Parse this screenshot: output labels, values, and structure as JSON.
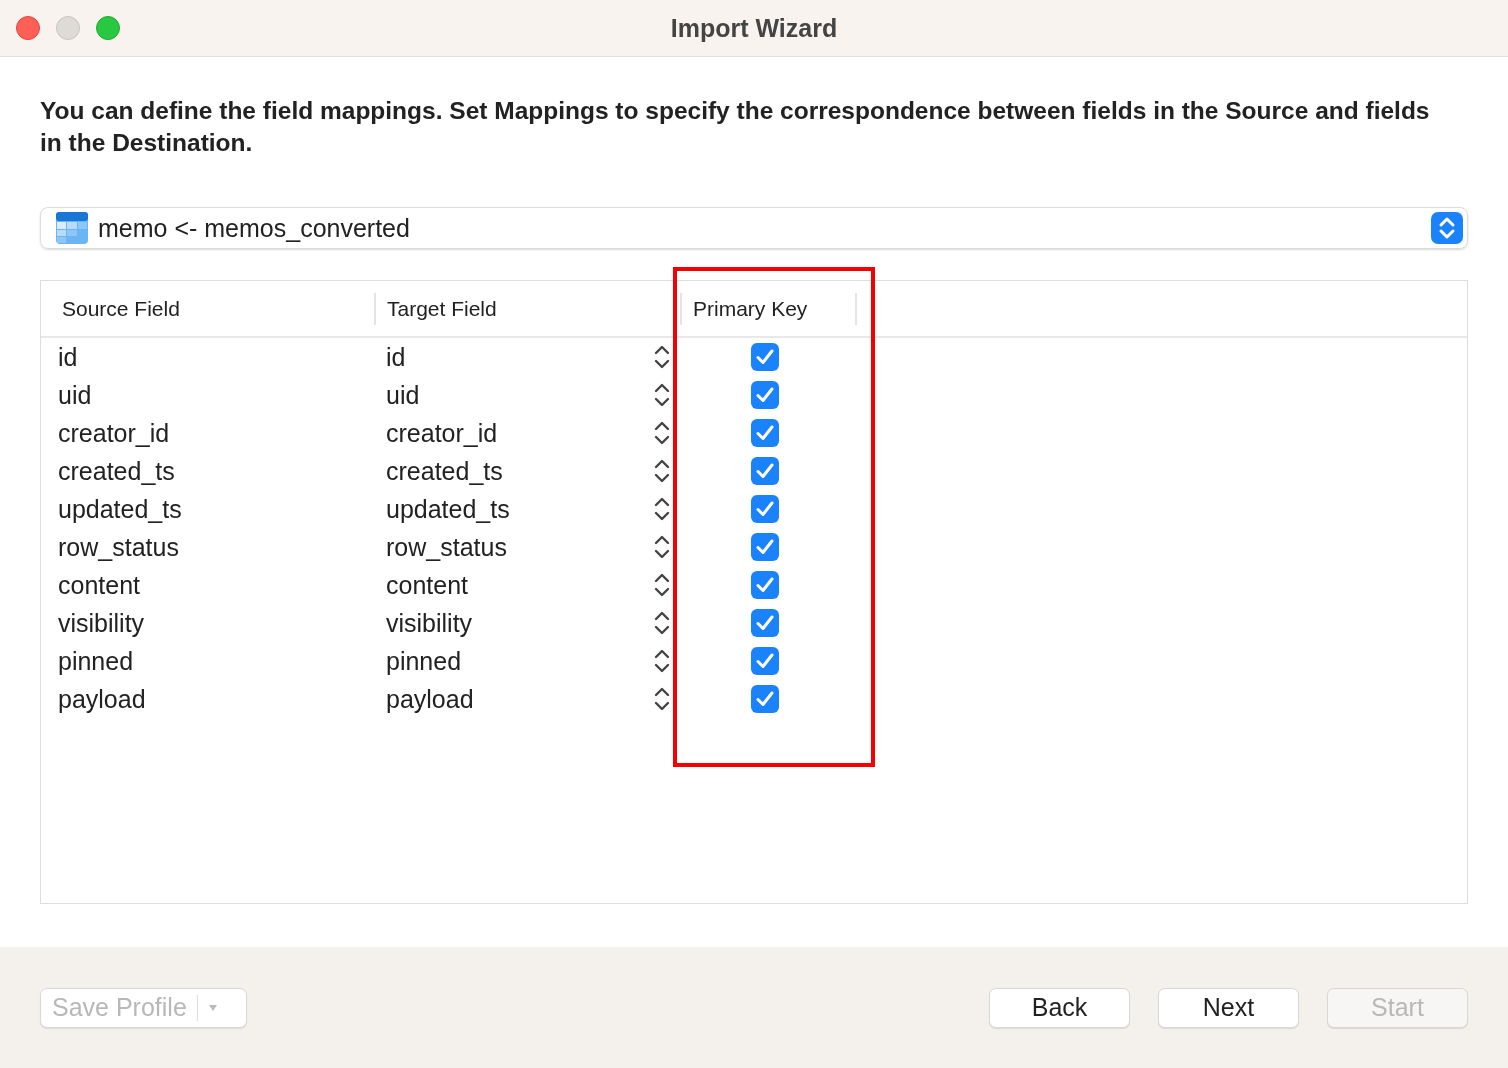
{
  "window": {
    "title": "Import Wizard"
  },
  "instruction": "You can define the field mappings. Set Mappings to specify the correspondence between fields in the Source and fields in the Destination.",
  "table_selector": {
    "value": "memo <- memos_converted"
  },
  "table": {
    "columns": [
      "Source Field",
      "Target Field",
      "Primary Key"
    ],
    "rows": [
      {
        "source": "id",
        "target": "id",
        "primary_key": true
      },
      {
        "source": "uid",
        "target": "uid",
        "primary_key": true
      },
      {
        "source": "creator_id",
        "target": "creator_id",
        "primary_key": true
      },
      {
        "source": "created_ts",
        "target": "created_ts",
        "primary_key": true
      },
      {
        "source": "updated_ts",
        "target": "updated_ts",
        "primary_key": true
      },
      {
        "source": "row_status",
        "target": "row_status",
        "primary_key": true
      },
      {
        "source": "content",
        "target": "content",
        "primary_key": true
      },
      {
        "source": "visibility",
        "target": "visibility",
        "primary_key": true
      },
      {
        "source": "pinned",
        "target": "pinned",
        "primary_key": true
      },
      {
        "source": "payload",
        "target": "payload",
        "primary_key": true
      }
    ]
  },
  "annotation": {
    "kind": "highlight"
  },
  "footer": {
    "save_profile": {
      "label": "Save Profile",
      "disabled": true
    },
    "buttons": [
      {
        "label": "Back",
        "disabled": false
      },
      {
        "label": "Next",
        "disabled": false
      },
      {
        "label": "Start",
        "disabled": true
      }
    ]
  }
}
